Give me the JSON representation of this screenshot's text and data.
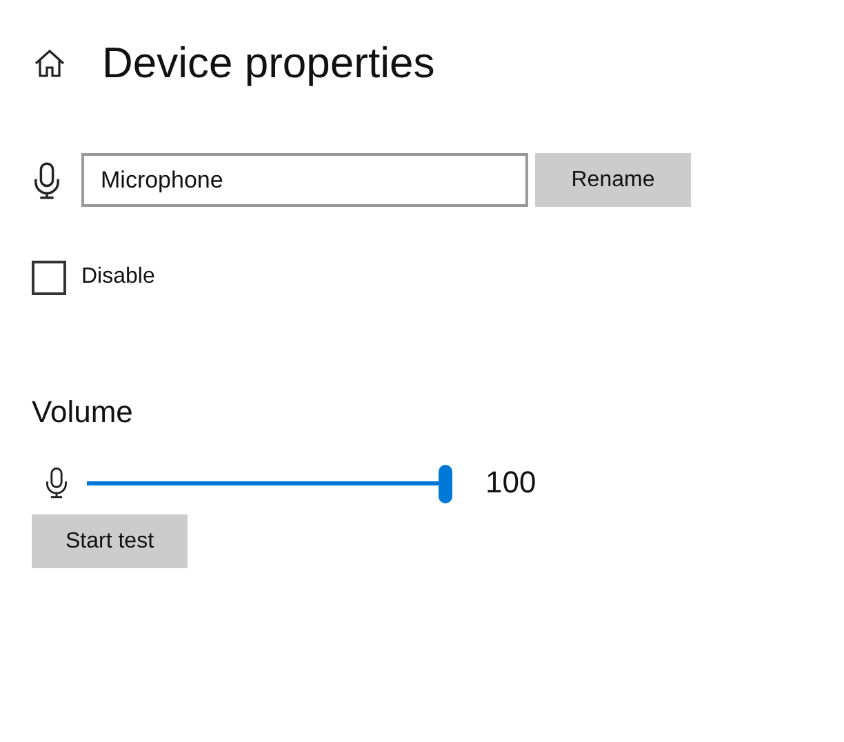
{
  "header": {
    "title": "Device properties"
  },
  "name_field": {
    "value": "Microphone",
    "button": "Rename"
  },
  "disable": {
    "label": "Disable",
    "checked": false
  },
  "volume": {
    "heading": "Volume",
    "level": 1.0,
    "reading": "100",
    "button": "Start test"
  }
}
